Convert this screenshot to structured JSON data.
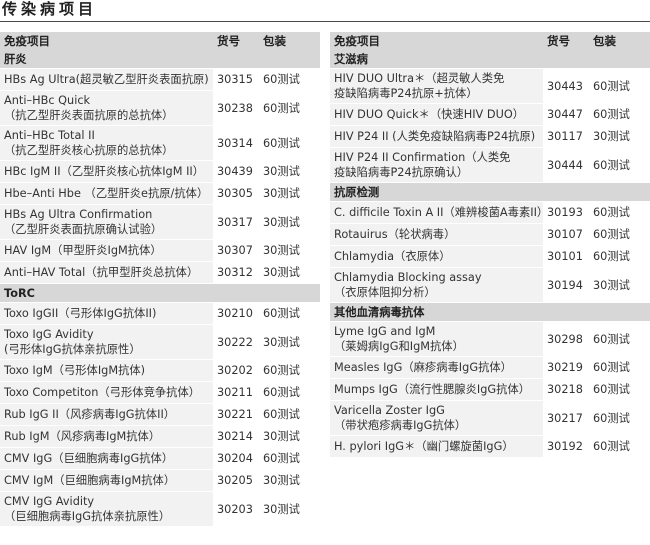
{
  "page": {
    "title": "传染病项目"
  },
  "columns": {
    "name": "免疫项目",
    "code": "货号",
    "pack": "包装"
  },
  "left": [
    {
      "category": "肝炎"
    },
    {
      "name": [
        "HBs Ag Ultra(超灵敏乙型肝炎表面抗原)"
      ],
      "code": "30315",
      "pack": "60测试"
    },
    {
      "name": [
        "Anti–HBc Quick",
        "（抗乙型肝炎表面抗原的总抗体）"
      ],
      "code": "30238",
      "pack": "60测试"
    },
    {
      "name": [
        "Anti–HBc Total II",
        "（抗乙型肝炎核心抗原的总抗体）"
      ],
      "code": "30314",
      "pack": "60测试"
    },
    {
      "name": [
        "HBc IgM II（乙型肝炎核心抗体IgM II）"
      ],
      "code": "30439",
      "pack": "30测试"
    },
    {
      "name": [
        "Hbe–Anti Hbe （乙型肝炎e抗原/抗体）"
      ],
      "code": "30305",
      "pack": "30测试"
    },
    {
      "name": [
        "HBs Ag Ultra Confirmation",
        "（乙型肝炎表面抗原确认试验）"
      ],
      "code": "30317",
      "pack": "30测试"
    },
    {
      "name": [
        "HAV IgM（甲型肝炎IgM抗体）"
      ],
      "code": "30307",
      "pack": "30测试"
    },
    {
      "name": [
        "Anti–HAV Total（抗甲型肝炎总抗体）"
      ],
      "code": "30312",
      "pack": "30测试"
    },
    {
      "category": "ToRC"
    },
    {
      "name": [
        "Toxo IgGII（弓形体IgG抗体II)"
      ],
      "code": "30210",
      "pack": "60测试"
    },
    {
      "name": [
        "Toxo IgG Avidity",
        "(弓形体IgG抗体亲抗原性）"
      ],
      "code": "30222",
      "pack": "30测试"
    },
    {
      "name": [
        "Toxo IgM（弓形体IgM抗体)"
      ],
      "code": "30202",
      "pack": "60测试"
    },
    {
      "name": [
        "Toxo Competiton（弓形体竞争抗体）"
      ],
      "code": "30211",
      "pack": "60测试"
    },
    {
      "name": [
        "Rub IgG II（风疹病毒IgG抗体II）"
      ],
      "code": "30221",
      "pack": "60测试"
    },
    {
      "name": [
        "Rub IgM（风疹病毒IgM抗体）"
      ],
      "code": "30214",
      "pack": "30测试"
    },
    {
      "name": [
        "CMV IgG（巨细胞病毒IgG抗体）"
      ],
      "code": "30204",
      "pack": "60测试"
    },
    {
      "name": [
        "CMV IgM（巨细胞病毒IgM抗体）"
      ],
      "code": "30205",
      "pack": "30测试"
    },
    {
      "name": [
        "CMV IgG Avidity",
        "（巨细胞病毒IgG抗体亲抗原性）"
      ],
      "code": "30203",
      "pack": "30测试"
    }
  ],
  "right": [
    {
      "category": "艾滋病"
    },
    {
      "name": [
        "HIV DUO Ultra＊（超灵敏人类免",
        "疫缺陷病毒P24抗原+抗体）"
      ],
      "code": "30443",
      "pack": "60测试"
    },
    {
      "name": [
        "HIV DUO Quick＊（快速HIV DUO）"
      ],
      "code": "30447",
      "pack": "60测试"
    },
    {
      "name": [
        "HIV P24 II (人类免疫缺陷病毒P24抗原)"
      ],
      "code": "30117",
      "pack": "30测试"
    },
    {
      "name": [
        "HIV P24 II Confirmation（人类免",
        "疫缺陷病毒P24抗原确认）"
      ],
      "code": "30444",
      "pack": "60测试"
    },
    {
      "category": "抗原检测"
    },
    {
      "name": [
        "C. difficile Toxin A II（难辨梭菌A毒素II）"
      ],
      "code": "30193",
      "pack": "60测试"
    },
    {
      "name": [
        "Rotauirus（轮状病毒）"
      ],
      "code": "30107",
      "pack": "60测试"
    },
    {
      "name": [
        "Chlamydia（衣原体）"
      ],
      "code": "30101",
      "pack": "60测试"
    },
    {
      "name": [
        "Chlamydia Blocking assay",
        "（衣原体阻抑分析）"
      ],
      "code": "30194",
      "pack": "30测试"
    },
    {
      "category": "其他血清病毒抗体"
    },
    {
      "name": [
        "Lyme IgG and IgM",
        "（莱姆病IgG和IgM抗体）"
      ],
      "code": "30298",
      "pack": "60测试"
    },
    {
      "name": [
        "Measles IgG（麻疹病毒IgG抗体）"
      ],
      "code": "30219",
      "pack": "60测试"
    },
    {
      "name": [
        "Mumps IgG（流行性腮腺炎IgG抗体）"
      ],
      "code": "30218",
      "pack": "60测试"
    },
    {
      "name": [
        "Varicella Zoster IgG",
        "（带状疱疹病毒IgG抗体）"
      ],
      "code": "30217",
      "pack": "60测试"
    },
    {
      "name": [
        "H. pylori IgG＊（幽门螺旋菌IgG）"
      ],
      "code": "30192",
      "pack": "60测试"
    }
  ]
}
